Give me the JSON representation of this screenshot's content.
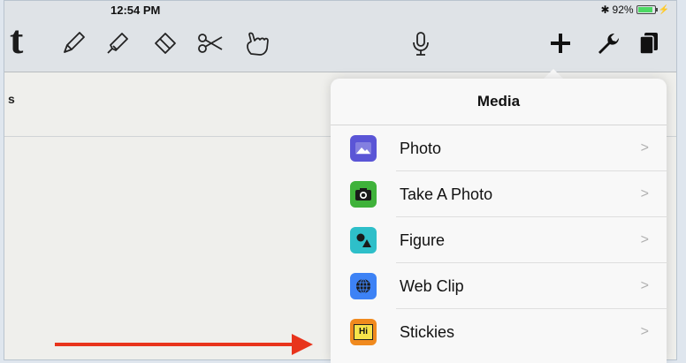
{
  "status_bar": {
    "time": "12:54 PM",
    "battery_text": "92%",
    "battery_level": 0.92,
    "charging_symbol": "⚡"
  },
  "toolbar": {
    "logo": "t",
    "tools": [
      "pen-icon",
      "highlighter-icon",
      "eraser-icon",
      "scissors-icon",
      "hand-pointer-icon"
    ],
    "right_tools": [
      "microphone-icon",
      "plus-icon",
      "wrench-icon",
      "pages-icon"
    ]
  },
  "canvas": {
    "fragment_text": "s"
  },
  "media_menu": {
    "title": "Media",
    "items": [
      {
        "label": "Photo",
        "icon": "photo-icon",
        "color": "#5a55d6"
      },
      {
        "label": "Take A Photo",
        "icon": "camera-icon",
        "color": "#3fb23a"
      },
      {
        "label": "Figure",
        "icon": "figure-icon",
        "color": "#2ebfc9"
      },
      {
        "label": "Web Clip",
        "icon": "globe-icon",
        "color": "#3d82f5"
      },
      {
        "label": "Stickies",
        "icon": "stickies-icon",
        "color": "#f08a1e"
      }
    ],
    "chevron": ">"
  },
  "colors": {
    "accent_arrow": "#e8341c"
  }
}
